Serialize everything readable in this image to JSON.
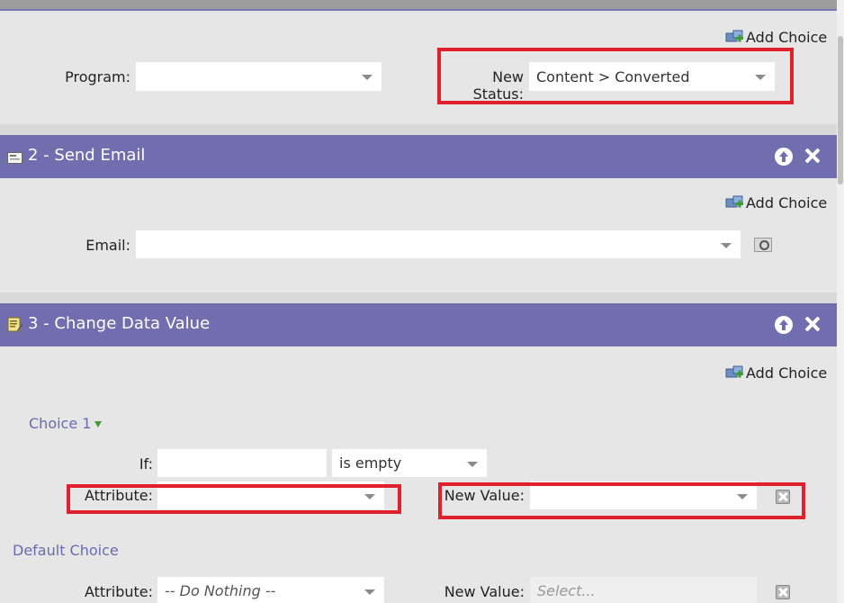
{
  "flow_step_1": {
    "add_choice_label": "Add Choice",
    "program_label": "Program:",
    "program_value": "",
    "new_status_label": "New Status:",
    "new_status_value": "Content > Converted"
  },
  "flow_step_2": {
    "title": "2 - Send Email",
    "add_choice_label": "Add Choice",
    "email_label": "Email:",
    "email_value": ""
  },
  "flow_step_3": {
    "title": "3 - Change Data Value",
    "add_choice_label": "Add Choice",
    "choice_1": {
      "label": "Choice 1",
      "if_label": "If:",
      "if_field_value": "",
      "if_operator_value": "is empty",
      "attribute_label": "Attribute:",
      "attribute_value": "",
      "new_value_label": "New Value:",
      "new_value_value": ""
    },
    "default_choice": {
      "label": "Default Choice",
      "attribute_label": "Attribute:",
      "attribute_value": "-- Do Nothing --",
      "new_value_label": "New Value:",
      "new_value_placeholder": "Select..."
    }
  },
  "colors": {
    "header_purple": "#716eb0",
    "highlight_red": "#e0212b",
    "choice_link": "#6a6ab0"
  }
}
